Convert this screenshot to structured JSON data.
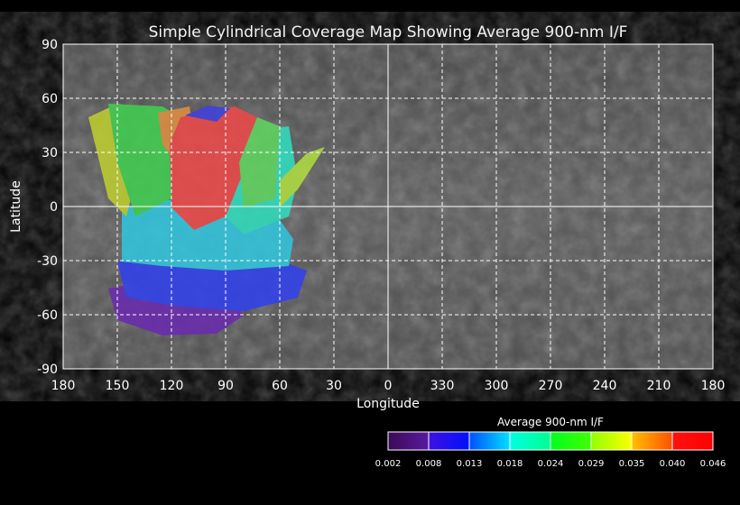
{
  "title": "Simple Cylindrical Coverage Map Showing Average 900-nm I/F",
  "xlabel": "Longitude",
  "ylabel": "Latitude",
  "x_ticks": [
    "180",
    "150",
    "120",
    "90",
    "60",
    "30",
    "0",
    "330",
    "300",
    "270",
    "240",
    "210",
    "180"
  ],
  "y_ticks": [
    "90",
    "60",
    "30",
    "0",
    "-30",
    "-60",
    "-90"
  ],
  "colorbar": {
    "title": "Average 900-nm I/F",
    "ticks": [
      "0.002",
      "0.008",
      "0.013",
      "0.018",
      "0.024",
      "0.029",
      "0.035",
      "0.040",
      "0.046"
    ],
    "segments": [
      [
        "#3a0a55",
        "#5a1aa0"
      ],
      [
        "#4010e0",
        "#0010ff"
      ],
      [
        "#0050ff",
        "#00e0ff"
      ],
      [
        "#00ffe0",
        "#00ff90"
      ],
      [
        "#00ff20",
        "#40ff00"
      ],
      [
        "#90ff00",
        "#ffff00"
      ],
      [
        "#ffc000",
        "#ff5000"
      ],
      [
        "#ff1010",
        "#ff0000"
      ]
    ]
  },
  "colors": {
    "background": "#000000",
    "grid": "#ffffff",
    "map_base": "#555555"
  }
}
